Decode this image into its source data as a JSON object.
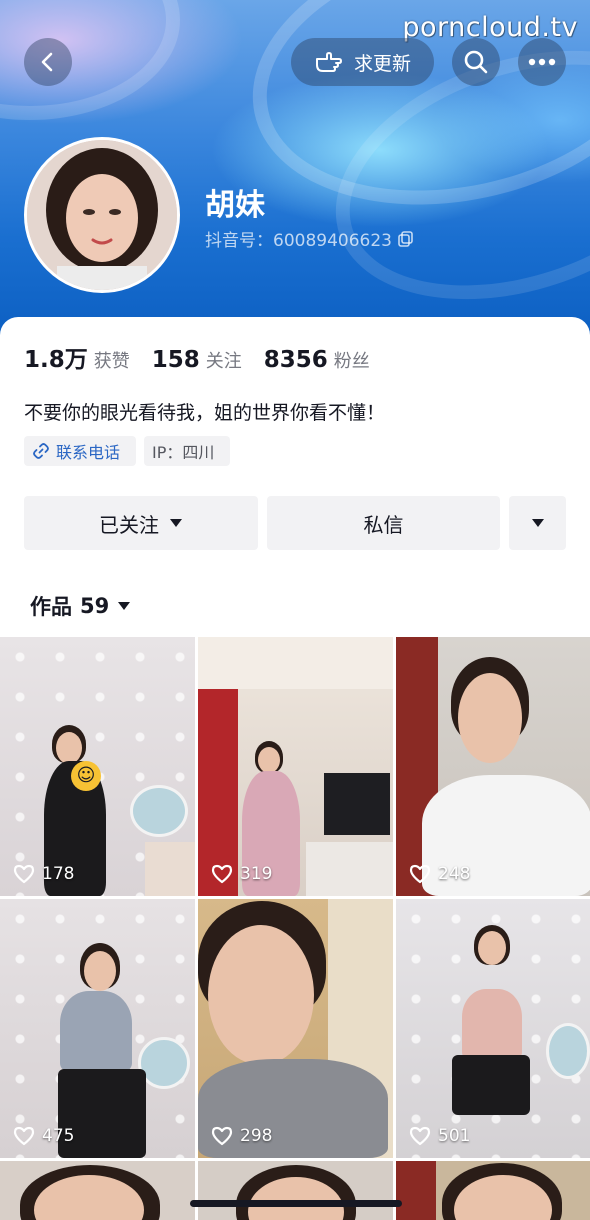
{
  "watermark": "porncloud.tv",
  "header": {
    "request_update_label": "求更新",
    "nickname": "胡妹",
    "douyin_id": "抖音号：60089406623"
  },
  "profile": {
    "stats": [
      {
        "num": "1.8万",
        "label": "获赞"
      },
      {
        "num": "158",
        "label": "关注"
      },
      {
        "num": "8356",
        "label": "粉丝"
      }
    ],
    "bio": "不要你的眼光看待我，姐的世界你看不懂！",
    "tags": {
      "phone": "联系电话",
      "ip": "IP：四川"
    },
    "buttons": {
      "follow": "已关注",
      "message": "私信"
    }
  },
  "works_tab": {
    "label": "作品",
    "count": "59"
  },
  "videos": [
    {
      "likes": "178"
    },
    {
      "likes": "319"
    },
    {
      "likes": "248"
    },
    {
      "likes": "475"
    },
    {
      "likes": "298"
    },
    {
      "likes": "501"
    }
  ],
  "colors": {
    "accent_link": "#2b67c4",
    "button_bg": "#f2f2f4",
    "header_blue": "#1a6fd0"
  }
}
